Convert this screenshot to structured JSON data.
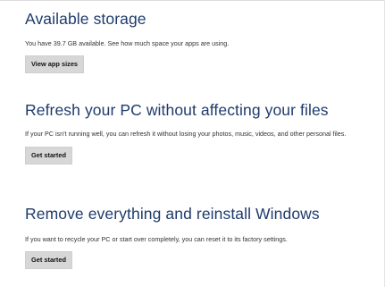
{
  "storage": {
    "heading": "Available storage",
    "description": "You have 39.7 GB available. See how much space your apps are using.",
    "button_label": "View app sizes"
  },
  "refresh": {
    "heading": "Refresh your PC without affecting your files",
    "description": "If your PC isn't running well, you can refresh it without losing your photos, music, videos, and other personal files.",
    "button_label": "Get started"
  },
  "remove": {
    "heading": "Remove everything and reinstall Windows",
    "description": "If you want to recycle your PC or start over completely, you can reset it to its factory settings.",
    "button_label": "Get started"
  }
}
